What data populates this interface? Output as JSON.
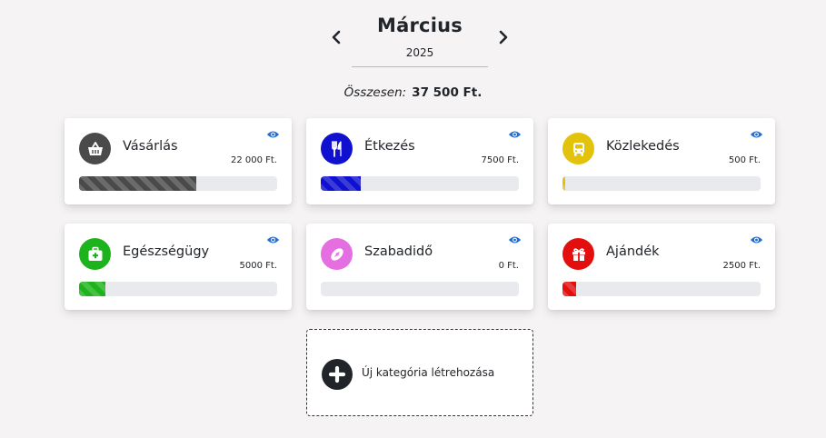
{
  "header": {
    "month": "Március",
    "year": "2025"
  },
  "summary": {
    "label": "Összesen:",
    "value": "37 500 Ft."
  },
  "categories": [
    {
      "name": "Vásárlás",
      "amount": "22 000 Ft.",
      "color": "#4a4a4a",
      "icon": "basket-icon",
      "share": 0.59
    },
    {
      "name": "Étkezés",
      "amount": "7500 Ft.",
      "color": "#1010d0",
      "icon": "utensils-icon",
      "share": 0.2
    },
    {
      "name": "Közlekedés",
      "amount": "500 Ft.",
      "color": "#e3c20c",
      "icon": "bus-icon",
      "share": 0.013
    },
    {
      "name": "Egészségügy",
      "amount": "5000 Ft.",
      "color": "#1db31d",
      "icon": "medkit-icon",
      "share": 0.133
    },
    {
      "name": "Szabadidő",
      "amount": "0 Ft.",
      "color": "#e56fe0",
      "icon": "football-icon",
      "share": 0
    },
    {
      "name": "Ajándék",
      "amount": "2500 Ft.",
      "color": "#e30f0f",
      "icon": "gift-icon",
      "share": 0.067
    }
  ],
  "new_category": {
    "label": "Új kategória létrehozása"
  },
  "colors": {
    "eye": "#1e6fd9",
    "background": "#f5f3f4"
  }
}
